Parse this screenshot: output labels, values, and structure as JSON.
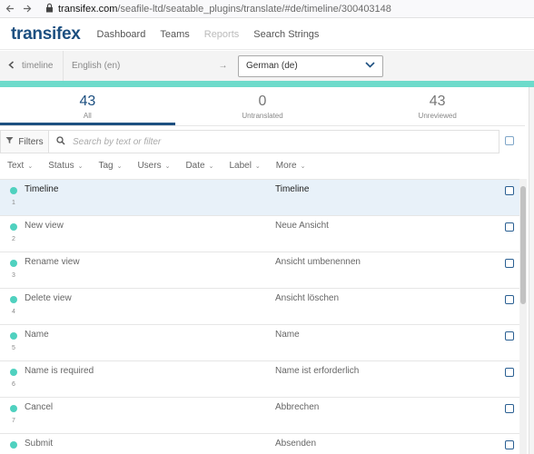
{
  "browser": {
    "host": "transifex.com",
    "path": "/seafile-ltd/seatable_plugins/translate/#de/timeline/300403148"
  },
  "app": {
    "logo": "transifex",
    "nav": [
      {
        "label": "Dashboard",
        "enabled": true
      },
      {
        "label": "Teams",
        "enabled": true
      },
      {
        "label": "Reports",
        "enabled": false
      },
      {
        "label": "Search Strings",
        "enabled": true
      }
    ]
  },
  "langbar": {
    "back_label": "timeline",
    "source_language": "English (en)",
    "arrow": "→",
    "target_language": "German (de)"
  },
  "stats": [
    {
      "count": "43",
      "label": "All",
      "active": true
    },
    {
      "count": "0",
      "label": "Untranslated",
      "active": false
    },
    {
      "count": "43",
      "label": "Unreviewed",
      "active": false
    }
  ],
  "filter": {
    "button_label": "Filters",
    "search_placeholder": "Search by text or filter"
  },
  "facets": [
    "Text",
    "Status",
    "Tag",
    "Users",
    "Date",
    "Label",
    "More"
  ],
  "strings": [
    {
      "index": "1",
      "source": "Timeline",
      "translation": "Timeline",
      "selected": true
    },
    {
      "index": "2",
      "source": "New view",
      "translation": "Neue Ansicht",
      "selected": false
    },
    {
      "index": "3",
      "source": "Rename view",
      "translation": "Ansicht umbenennen",
      "selected": false
    },
    {
      "index": "4",
      "source": "Delete view",
      "translation": "Ansicht löschen",
      "selected": false
    },
    {
      "index": "5",
      "source": "Name",
      "translation": "Name",
      "selected": false
    },
    {
      "index": "6",
      "source": "Name is required",
      "translation": "Name ist erforderlich",
      "selected": false
    },
    {
      "index": "7",
      "source": "Cancel",
      "translation": "Abbrechen",
      "selected": false
    },
    {
      "index": "8",
      "source": "Submit",
      "translation": "Absenden",
      "selected": false
    }
  ],
  "icons": {
    "back": "arrow-left-icon",
    "forward": "arrow-right-icon",
    "lock": "lock-icon",
    "filter": "filter-icon",
    "search": "search-icon",
    "dropdown": "chevron-down-icon"
  },
  "colors": {
    "brand": "#1c4f80",
    "teal": "#6ddbcb",
    "status_dot": "#4fd1bf",
    "selected_row": "#e8f1f9"
  }
}
